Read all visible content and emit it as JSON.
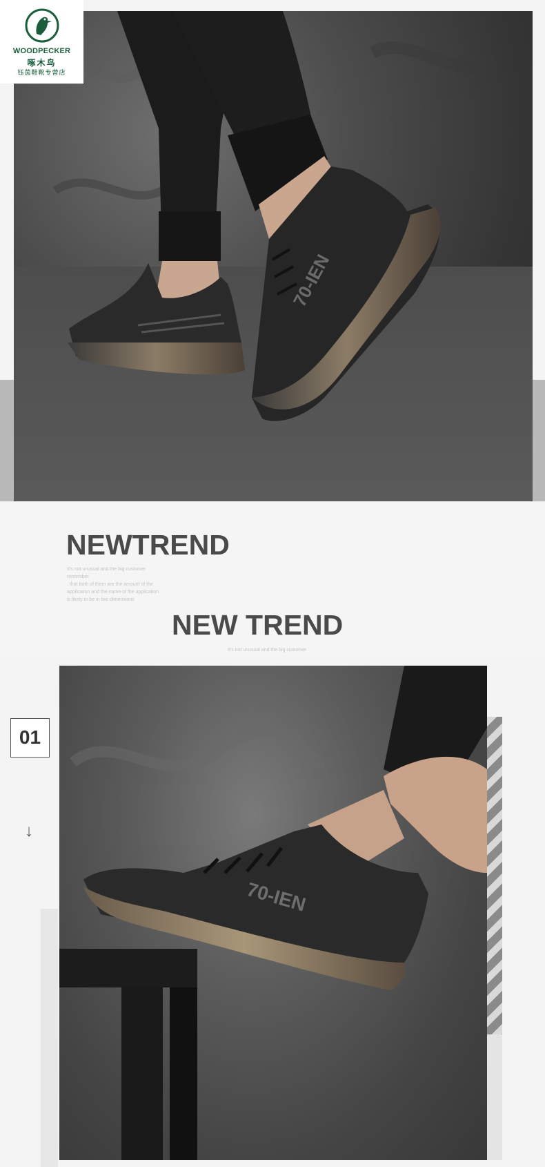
{
  "brand": {
    "name_en": "WOODPECKER",
    "name_cn": "啄木鸟",
    "store": "钰茵鞋靴专营店",
    "icon": "woodpecker-logo-icon",
    "color": "#1a5e3c"
  },
  "hero": {
    "shoe_text": "70-IEN",
    "icon": "sneaker-photo"
  },
  "trend": {
    "title_1": "NEWTREND",
    "blurb_lines": [
      "It's not unusual and the big customer",
      "remember",
      ". that both of them are the amount of the",
      "application and the name of the application",
      "is likely to be in two dimensions"
    ],
    "title_2": "NEW TREND",
    "subtitle_2": "It's not unusual and the big customer"
  },
  "step": {
    "number": "01",
    "arrow": "↓"
  },
  "detail_photo": {
    "shoe_text": "70-IEN"
  },
  "colors": {
    "title": "#4a4a4a",
    "muted": "#c4c4c4",
    "background": "#f4f4f4"
  }
}
